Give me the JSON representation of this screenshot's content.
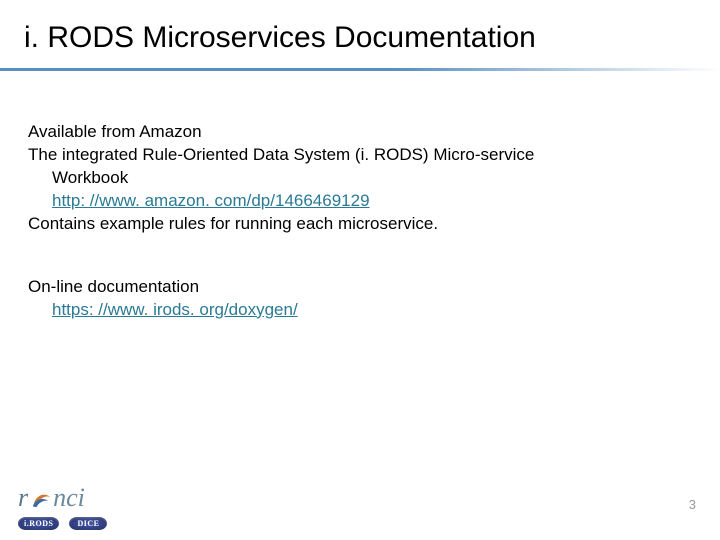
{
  "title": "i. RODS Microservices Documentation",
  "section1": {
    "line1": "Available from Amazon",
    "line2": "The integrated Rule-Oriented Data System (i. RODS) Micro-service",
    "line3": "Workbook",
    "link1": "http: //www. amazon. com/dp/1466469129",
    "line4": "Contains example rules for running each microservice."
  },
  "section2": {
    "line1": "On-line documentation",
    "link1": "https: //www. irods. org/doxygen/"
  },
  "footer": {
    "logo_text_1": "r",
    "logo_text_2": "nci",
    "badge1": "i.RODS",
    "badge2": "DICE"
  },
  "page_number": "3"
}
